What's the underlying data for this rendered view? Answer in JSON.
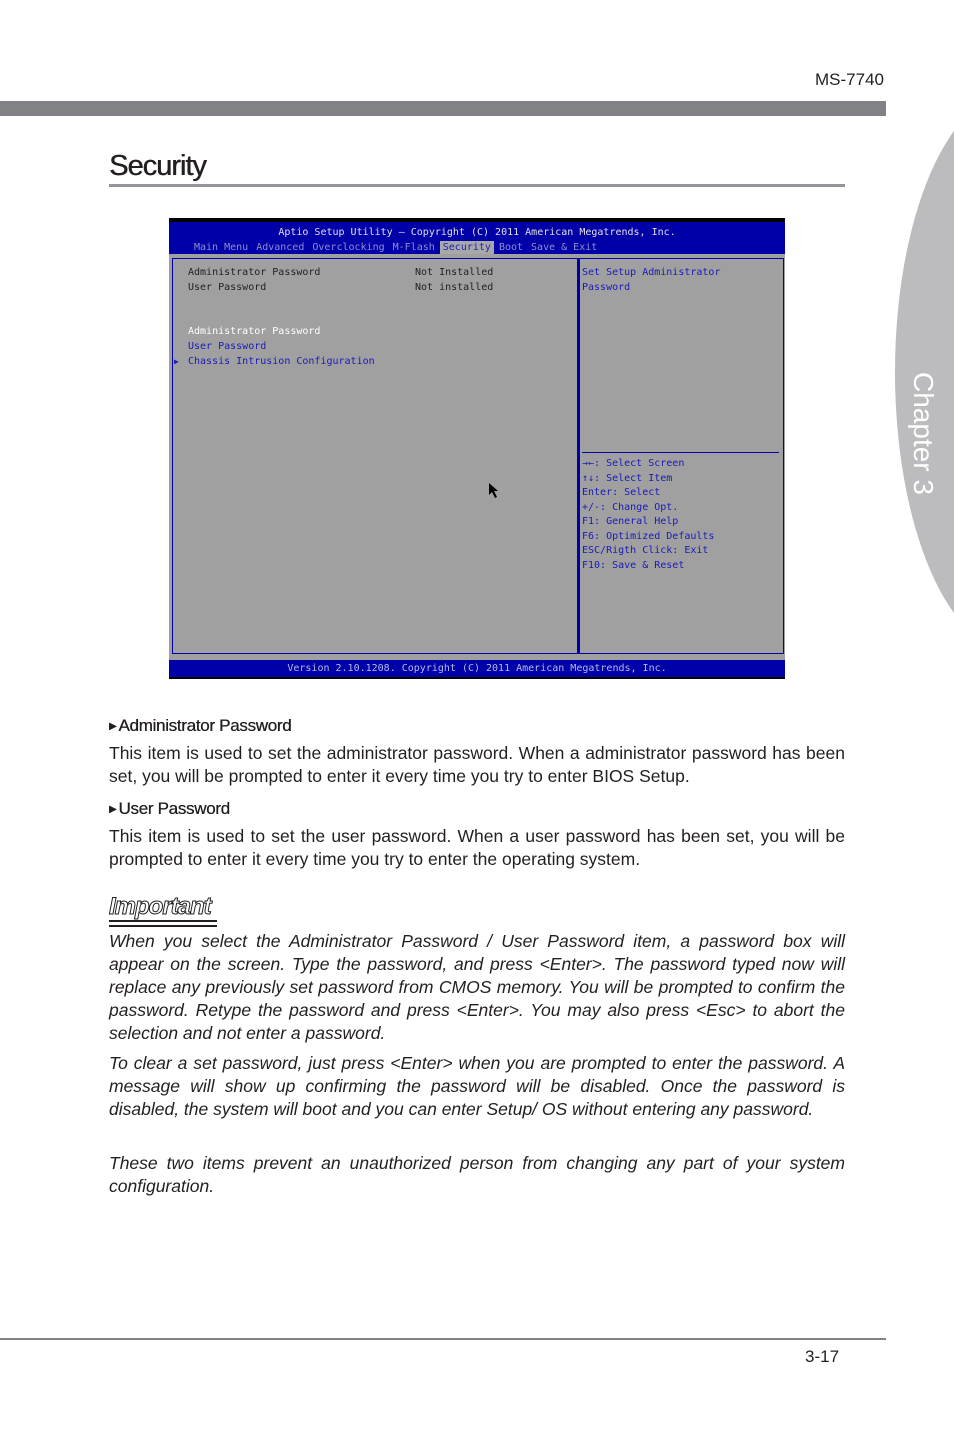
{
  "header": {
    "model": "MS-7740",
    "chapter": "Chapter 3"
  },
  "section": {
    "title": "Security"
  },
  "bios": {
    "title": "Aptio Setup Utility – Copyright (C) 2011 American Megatrends, Inc.",
    "tabs": [
      {
        "label": "Main Menu",
        "active": false
      },
      {
        "label": "Advanced",
        "active": false
      },
      {
        "label": "Overclocking",
        "active": false
      },
      {
        "label": "M-Flash",
        "active": false
      },
      {
        "label": "Security",
        "active": true
      },
      {
        "label": "Boot",
        "active": false
      },
      {
        "label": "Save & Exit",
        "active": false
      }
    ],
    "status_rows": [
      {
        "label": "Administrator Password",
        "value": "Not Installed"
      },
      {
        "label": "User Password",
        "value": "Not installed"
      }
    ],
    "menu_items": [
      {
        "label": "Administrator Password",
        "state": "selected"
      },
      {
        "label": "User Password",
        "state": "normal"
      },
      {
        "label": "Chassis Intrusion Configuration",
        "state": "submenu",
        "marker": "▶"
      }
    ],
    "help_text": [
      "Set Setup Administrator",
      "Password"
    ],
    "key_help": [
      "→←: Select Screen",
      "↑↓: Select Item",
      "Enter: Select",
      "+/-: Change Opt.",
      "F1: General Help",
      "F6: Optimized Defaults",
      "ESC/Rigth Click: Exit",
      "F10: Save & Reset"
    ],
    "footer": "Version 2.10.1208. Copyright (C) 2011 American Megatrends, Inc."
  },
  "items": [
    {
      "marker": "▶",
      "heading": "Administrator Password",
      "text": "This item is used to set the administrator password. When a administrator password has been set, you will be prompted to enter it every time you try to enter BIOS Setup."
    },
    {
      "marker": "▶",
      "heading": "User Password",
      "text": "This item is used to set the user password. When a user password has been set, you will be prompted to enter it every time you try to enter the operating system."
    }
  ],
  "important": {
    "title": "Important",
    "paragraphs": [
      "When you select the Administrator Password / User Password item, a password box will appear on the screen. Type the password, and press <Enter>. The password typed now will replace any previously set password from CMOS memory. You will be prompted to confirm the password. Retype the password and press <Enter>. You may also press <Esc> to abort the selection and not enter a password.",
      "To clear a set password, just press <Enter> when you are prompted to enter the password. A message will show up confirming the password will be disabled. Once the password is disabled, the system will boot and you can enter Setup/ OS without entering any password.",
      "These two items prevent an unauthorized person from changing any part of your system configuration."
    ]
  },
  "footer": {
    "page_number": "3-17"
  }
}
